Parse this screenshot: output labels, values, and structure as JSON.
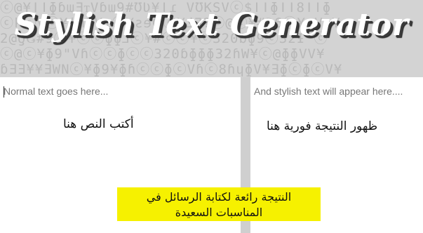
{
  "header": {
    "title": "Stylish Text Generator",
    "background_rows": [
      "ⓒ@¥ǀǀɸɓɯƎᴛVɓɯ9#ƱƲ¥ǀɾ VƱKSVⓒ$ǀǀɸǀǀ8ǀǀɸ",
      "ⓒkⓒVⓒ¥|ɦɓVʇⓒ¥ƨɘᗡⓒ¥⅃Ǝ?ⓒ@ⓒ¥#Ɖ6ⓒ¥ƨV ¥",
      "2@ƍǤ#9ⓒ¥ⓒⓒɸɸ⅃ⓒ¥#ⓒⓒ¥ⓒ320ɓɸ9ⓒ32Ɨ ⓒ",
      "ⓒ@ⓒ¥ɸ9\"Vɦⓒⓒɸⓒⓒ320ɓɸɸɸ32ɦW¥ⓒ@ɸɸVV¥",
      "ɓƎƎ¥¥ƎWNⓒ¥ɸ9¥ɸɦⓒⓒɸⓒVɦⓒ8ɦɥɸV¥ƎɸⓒɸⓒV¥"
    ]
  },
  "input_panel": {
    "placeholder": "Normal text goes here...",
    "value": ""
  },
  "output_panel": {
    "placeholder": "And stylish text will appear here....",
    "value": ""
  },
  "overlay": {
    "input_hint": "أكتب النص هنا",
    "output_hint": "ظهور النتيجة فورية هنا",
    "banner_line_1": "النتيجة رائعة لكتابة الرسائل في",
    "banner_line_2": "المناسبات السعيدة"
  },
  "colors": {
    "banner": "#f6f100",
    "title": "#ffffff",
    "title_shadow": "#3a3a3a",
    "background": "#d3d3d3"
  }
}
